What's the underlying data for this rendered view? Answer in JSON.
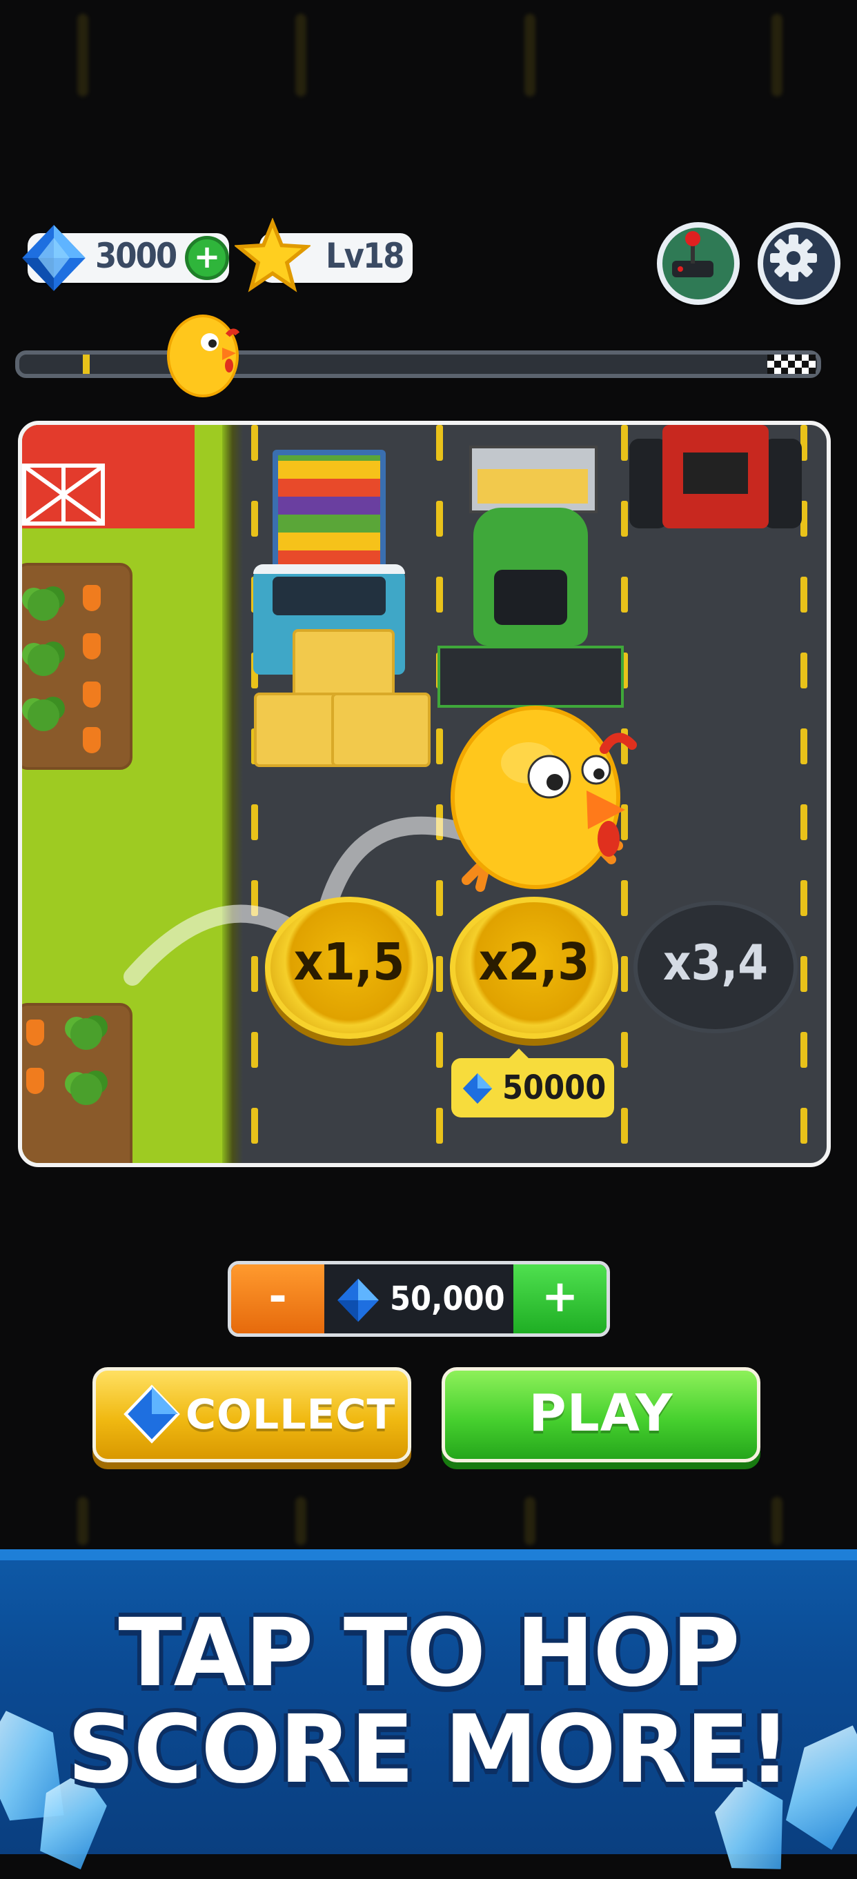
{
  "hud": {
    "gems": "3000",
    "level": "Lv18",
    "add_gems_icon": "plus-icon",
    "joystick_icon": "joystick-icon",
    "settings_icon": "gear-icon"
  },
  "progress": {
    "value": 0.08,
    "finish_icon": "checkered-flag-icon"
  },
  "board": {
    "multipliers": [
      {
        "label": "x1,5",
        "state": "unlocked"
      },
      {
        "label": "x2,3",
        "state": "unlocked"
      },
      {
        "label": "x3,4",
        "state": "locked"
      }
    ],
    "price": "50000"
  },
  "bet": {
    "minus": "-",
    "value": "50,000",
    "plus": "+"
  },
  "buttons": {
    "collect": "COLLECT",
    "play": "PLAY"
  },
  "banner": {
    "line1": "TAP TO HOP",
    "line2": "SCORE MORE!"
  },
  "colors": {
    "gold": "#f0b90a",
    "green": "#47d12f",
    "lane_yellow": "#e9c21a",
    "banner_blue": "#0b4a93"
  }
}
